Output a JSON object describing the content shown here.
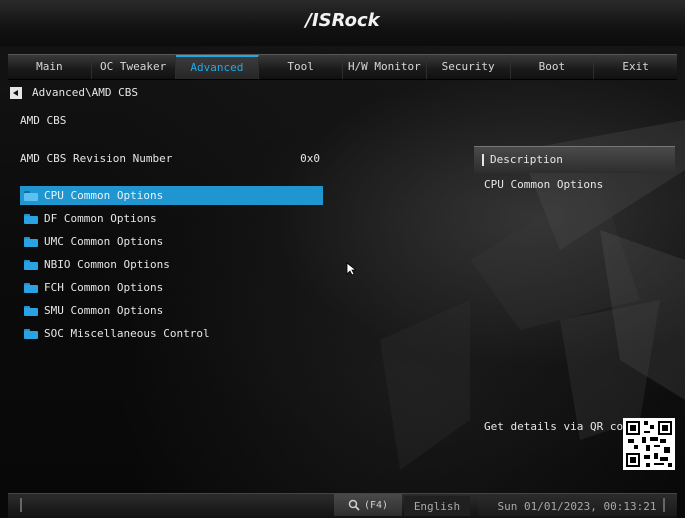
{
  "brand": "/ISRock",
  "tabs": [
    {
      "label": "Main"
    },
    {
      "label": "OC Tweaker"
    },
    {
      "label": "Advanced"
    },
    {
      "label": "Tool"
    },
    {
      "label": "H/W Monitor"
    },
    {
      "label": "Security"
    },
    {
      "label": "Boot"
    },
    {
      "label": "Exit"
    }
  ],
  "active_tab": "Advanced",
  "breadcrumb": "Advanced\\AMD CBS",
  "page_title": "AMD CBS",
  "revision": {
    "label": "AMD CBS Revision Number",
    "value": "0x0"
  },
  "menu_items": [
    {
      "label": "CPU Common Options",
      "selected": true
    },
    {
      "label": "DF Common Options"
    },
    {
      "label": "UMC Common Options"
    },
    {
      "label": "NBIO Common Options"
    },
    {
      "label": "FCH Common Options"
    },
    {
      "label": "SMU Common Options"
    },
    {
      "label": "SOC Miscellaneous Control"
    }
  ],
  "description": {
    "heading": "Description",
    "text": "CPU Common Options",
    "qr_label": "Get details via QR code"
  },
  "footer": {
    "search_label": "(F4)",
    "language": "English",
    "datetime": "Sun 01/01/2023, 00:13:21"
  },
  "colors": {
    "accent": "#1f96cf",
    "background": "#0a0a0a"
  },
  "icons": {
    "folder": "folder-icon",
    "search": "search-icon",
    "back": "back-arrow-icon",
    "cursor": "mouse-cursor-icon",
    "qr": "qr-code-icon"
  }
}
